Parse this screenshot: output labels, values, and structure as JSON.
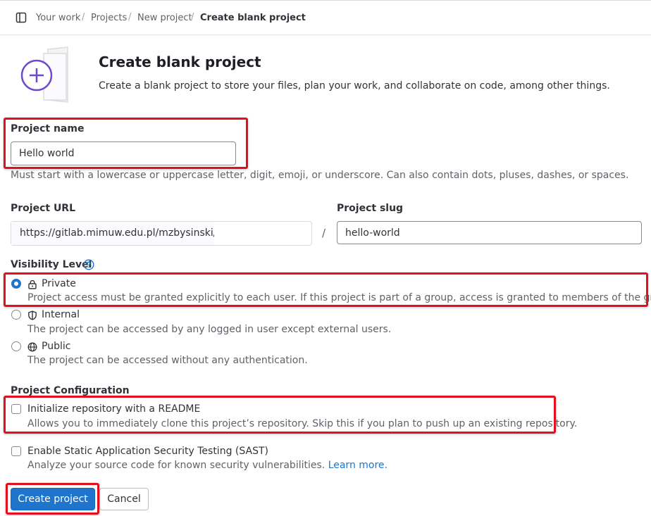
{
  "breadcrumb": {
    "items": [
      "Your work",
      "Projects",
      "New project"
    ],
    "current": "Create blank project",
    "separator": "/"
  },
  "header": {
    "title": "Create blank project",
    "description": "Create a blank project to store your files, plan your work, and collaborate on code, among other things."
  },
  "form": {
    "project_name": {
      "label": "Project name",
      "value": "Hello world",
      "help": "Must start with a lowercase or uppercase letter, digit, emoji, or underscore. Can also contain dots, pluses, dashes, or spaces."
    },
    "project_url": {
      "label": "Project URL",
      "prefix": "https://gitlab.mimuw.edu.pl/mzbysinski/",
      "separator": "/"
    },
    "project_slug": {
      "label": "Project slug",
      "value": "hello-world"
    },
    "visibility": {
      "label": "Visibility Level",
      "help_icon": "question-circle-icon",
      "options": [
        {
          "label": "Private",
          "icon": "lock-icon",
          "description": "Project access must be granted explicitly to each user. If this project is part of a group, access is granted to members of the group.",
          "selected": true
        },
        {
          "label": "Internal",
          "icon": "shield-icon",
          "description": "The project can be accessed by any logged in user except external users.",
          "selected": false
        },
        {
          "label": "Public",
          "icon": "globe-icon",
          "description": "The project can be accessed without any authentication.",
          "selected": false
        }
      ]
    },
    "configuration": {
      "label": "Project Configuration",
      "readme": {
        "label": "Initialize repository with a README",
        "description": "Allows you to immediately clone this project’s repository. Skip this if you plan to push up an existing repository.",
        "checked": false
      },
      "sast": {
        "label": "Enable Static Application Security Testing (SAST)",
        "description": "Analyze your source code for known security vulnerabilities.",
        "link": "Learn more.",
        "checked": false
      }
    }
  },
  "actions": {
    "create": "Create project",
    "cancel": "Cancel"
  },
  "colors": {
    "primary": "#1f75cb",
    "highlight": "#e0101f",
    "illustration_accent": "#6e49cb"
  }
}
